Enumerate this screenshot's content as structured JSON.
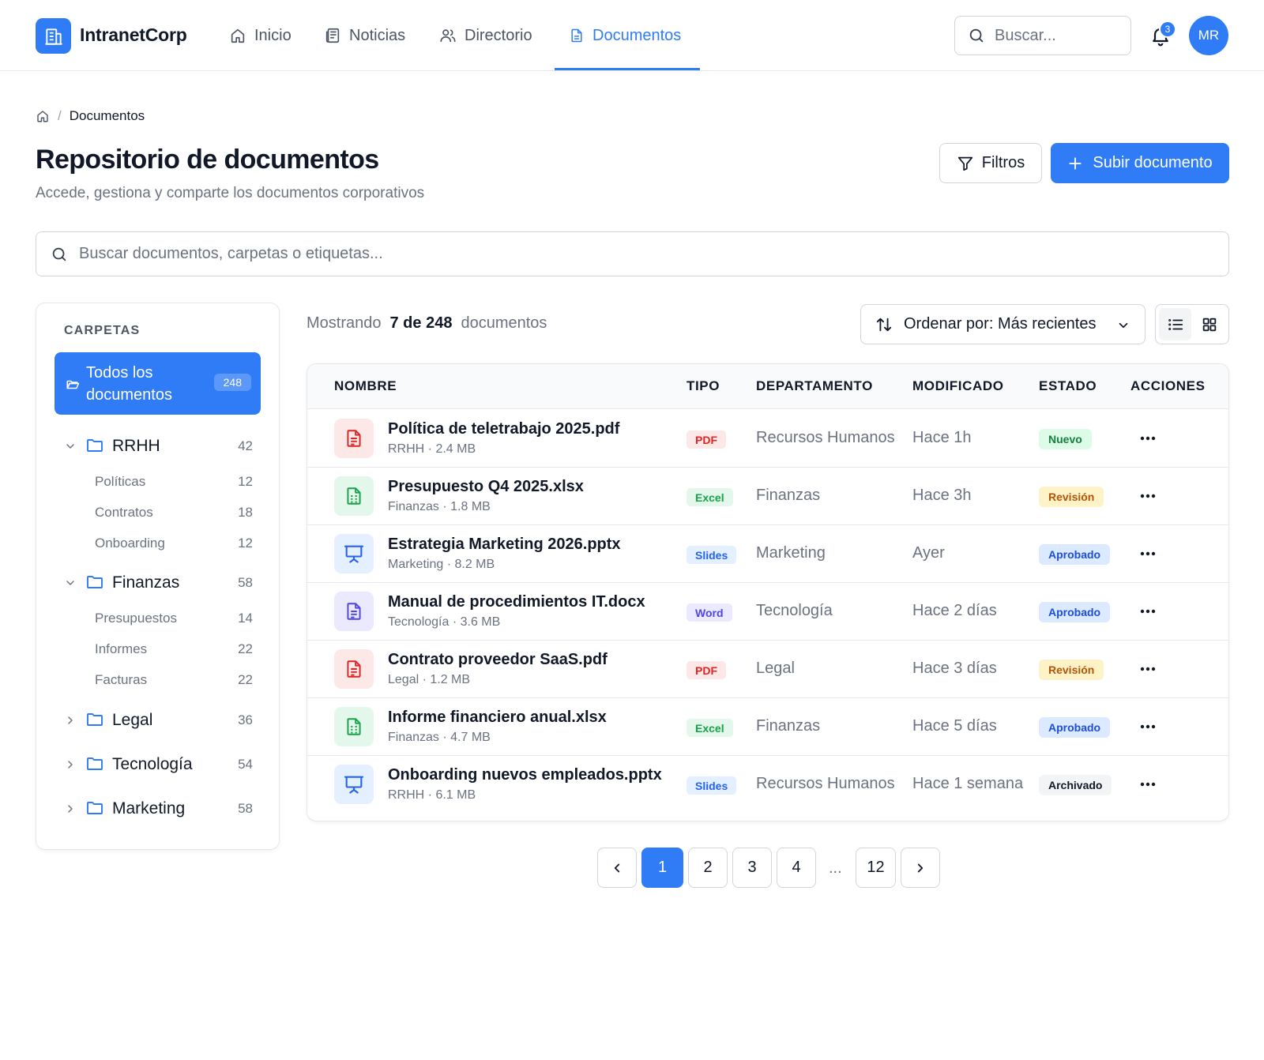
{
  "app": {
    "name": "IntranetCorp"
  },
  "nav": [
    {
      "label": "Inicio",
      "icon": "home-icon",
      "active": false
    },
    {
      "label": "Noticias",
      "icon": "newspaper-icon",
      "active": false
    },
    {
      "label": "Directorio",
      "icon": "users-icon",
      "active": false
    },
    {
      "label": "Documentos",
      "icon": "document-icon",
      "active": true
    }
  ],
  "header": {
    "search_placeholder": "Buscar...",
    "notifications_count": "3",
    "avatar_initials": "MR"
  },
  "breadcrumb": {
    "current": "Documentos",
    "separator": "/"
  },
  "page": {
    "title": "Repositorio de documentos",
    "subtitle": "Accede, gestiona y comparte los documentos corporativos",
    "filters_label": "Filtros",
    "upload_label": "Subir documento",
    "search_placeholder": "Buscar documentos, carpetas o etiquetas..."
  },
  "sidebar": {
    "heading": "CARPETAS",
    "all": {
      "label": "Todos los documentos",
      "count": "248"
    },
    "folders": [
      {
        "name": "RRHH",
        "count": "42",
        "expanded": true,
        "children": [
          {
            "name": "Políticas",
            "count": "12"
          },
          {
            "name": "Contratos",
            "count": "18"
          },
          {
            "name": "Onboarding",
            "count": "12"
          }
        ]
      },
      {
        "name": "Finanzas",
        "count": "58",
        "expanded": true,
        "children": [
          {
            "name": "Presupuestos",
            "count": "14"
          },
          {
            "name": "Informes",
            "count": "22"
          },
          {
            "name": "Facturas",
            "count": "22"
          }
        ]
      },
      {
        "name": "Legal",
        "count": "36",
        "expanded": false,
        "children": []
      },
      {
        "name": "Tecnología",
        "count": "54",
        "expanded": false,
        "children": []
      },
      {
        "name": "Marketing",
        "count": "58",
        "expanded": false,
        "children": []
      }
    ]
  },
  "results": {
    "prefix": "Mostrando",
    "count": "7 de 248",
    "suffix": "documentos",
    "sort_label": "Ordenar por: Más recientes"
  },
  "table": {
    "headers": [
      "NOMBRE",
      "TIPO",
      "DEPARTAMENTO",
      "MODIFICADO",
      "ESTADO",
      "ACCIONES"
    ],
    "rows": [
      {
        "name": "Política de teletrabajo 2025.pdf",
        "meta": "RRHH · 2.4 MB",
        "type": "PDF",
        "icon": "file-text-icon",
        "department": "Recursos Humanos",
        "modified": "Hace 1h",
        "status": "Nuevo"
      },
      {
        "name": "Presupuesto Q4 2025.xlsx",
        "meta": "Finanzas · 1.8 MB",
        "type": "Excel",
        "icon": "spreadsheet-icon",
        "department": "Finanzas",
        "modified": "Hace 3h",
        "status": "Revisión"
      },
      {
        "name": "Estrategia Marketing 2026.pptx",
        "meta": "Marketing · 8.2 MB",
        "type": "Slides",
        "icon": "presentation-icon",
        "department": "Marketing",
        "modified": "Ayer",
        "status": "Aprobado"
      },
      {
        "name": "Manual de procedimientos IT.docx",
        "meta": "Tecnología · 3.6 MB",
        "type": "Word",
        "icon": "file-text-icon",
        "department": "Tecnología",
        "modified": "Hace 2 días",
        "status": "Aprobado"
      },
      {
        "name": "Contrato proveedor SaaS.pdf",
        "meta": "Legal · 1.2 MB",
        "type": "PDF",
        "icon": "file-text-icon",
        "department": "Legal",
        "modified": "Hace 3 días",
        "status": "Revisión"
      },
      {
        "name": "Informe financiero anual.xlsx",
        "meta": "Finanzas · 4.7 MB",
        "type": "Excel",
        "icon": "spreadsheet-icon",
        "department": "Finanzas",
        "modified": "Hace 5 días",
        "status": "Aprobado"
      },
      {
        "name": "Onboarding nuevos empleados.pptx",
        "meta": "RRHH · 6.1 MB",
        "type": "Slides",
        "icon": "presentation-icon",
        "department": "Recursos Humanos",
        "modified": "Hace 1 semana",
        "status": "Archivado"
      }
    ]
  },
  "pagination": {
    "pages": [
      "1",
      "2",
      "3",
      "4"
    ],
    "ellipsis": "...",
    "last": "12",
    "current": "1"
  },
  "colors": {
    "accent": "#2f7cf6",
    "pdf": {
      "bg": "#fde8e8",
      "fg": "#dc2626"
    },
    "excel": {
      "bg": "#e3f7ea",
      "fg": "#16a34a"
    },
    "slides": {
      "bg": "#e4efff",
      "fg": "#2563eb"
    },
    "word": {
      "bg": "#ebe9fe",
      "fg": "#4f46e5"
    },
    "status_nuevo": {
      "bg": "#dcfce7",
      "fg": "#15803d"
    },
    "status_revision": {
      "bg": "#fef3c7",
      "fg": "#b45309"
    },
    "status_aprobado": {
      "bg": "#dbeafe",
      "fg": "#1d4ed8"
    },
    "status_archivado": {
      "bg": "#f3f4f6",
      "fg": "#111827"
    }
  }
}
